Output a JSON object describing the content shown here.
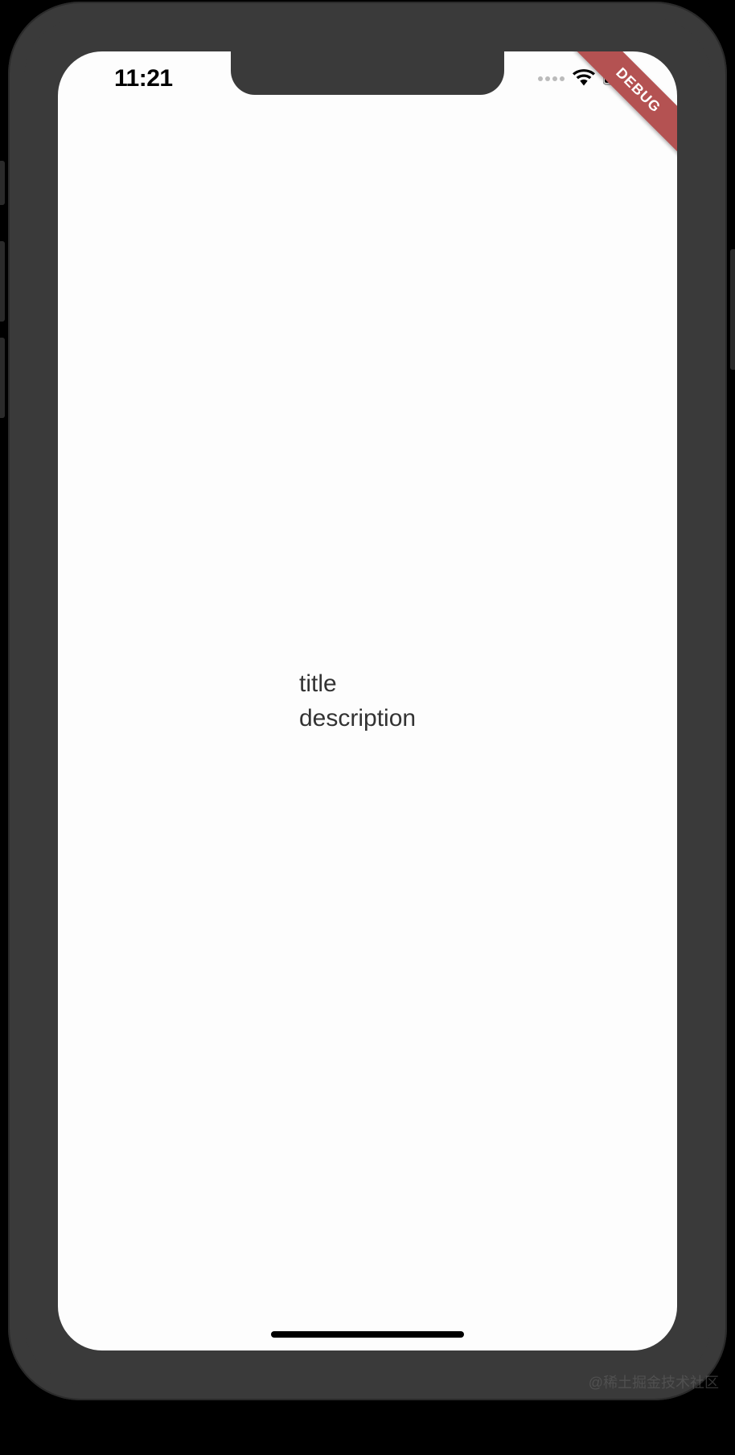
{
  "status_bar": {
    "time": "11:21"
  },
  "debug_banner": {
    "label": "DEBUG"
  },
  "content": {
    "title": "title",
    "description": "description"
  },
  "watermark": "@稀土掘金技术社区"
}
